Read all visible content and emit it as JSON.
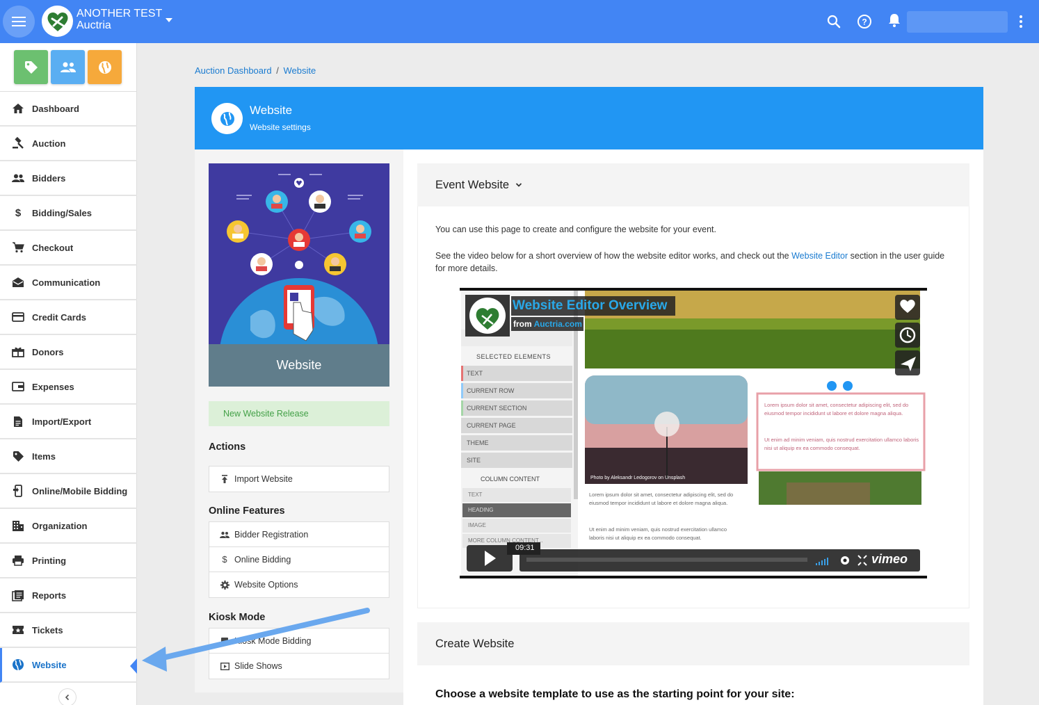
{
  "topbar": {
    "org_name": "ANOTHER TEST",
    "org_sub": "Auctria",
    "icons": [
      "menu-icon",
      "search-icon",
      "help-icon",
      "bell-icon",
      "more-vert-icon"
    ]
  },
  "sidebar": {
    "quick_links": [
      {
        "icon": "tag-icon",
        "color": "#6cc070"
      },
      {
        "icon": "people-icon",
        "color": "#5aaef2"
      },
      {
        "icon": "globe-icon",
        "color": "#f6a93b"
      }
    ],
    "items": [
      {
        "label": "Dashboard",
        "icon": "home-icon"
      },
      {
        "label": "Auction",
        "icon": "gavel-icon"
      },
      {
        "label": "Bidders",
        "icon": "people-icon"
      },
      {
        "label": "Bidding/Sales",
        "icon": "dollar-icon"
      },
      {
        "label": "Checkout",
        "icon": "cart-icon"
      },
      {
        "label": "Communication",
        "icon": "mail-icon"
      },
      {
        "label": "Credit Cards",
        "icon": "credit-card-icon"
      },
      {
        "label": "Donors",
        "icon": "gift-icon"
      },
      {
        "label": "Expenses",
        "icon": "expense-icon"
      },
      {
        "label": "Import/Export",
        "icon": "document-icon"
      },
      {
        "label": "Items",
        "icon": "tag-icon"
      },
      {
        "label": "Online/Mobile Bidding",
        "icon": "mobile-icon"
      },
      {
        "label": "Organization",
        "icon": "building-icon"
      },
      {
        "label": "Printing",
        "icon": "printer-icon"
      },
      {
        "label": "Reports",
        "icon": "reports-icon"
      },
      {
        "label": "Tickets",
        "icon": "ticket-icon"
      },
      {
        "label": "Website",
        "icon": "globe-icon",
        "active": true
      }
    ]
  },
  "breadcrumb": {
    "root": "Auction Dashboard",
    "separator": "/",
    "current": "Website"
  },
  "header": {
    "title": "Website",
    "subtitle": "Website settings"
  },
  "left": {
    "promo_label": "Website",
    "release": "New Website Release",
    "actions_title": "Actions",
    "actions": [
      {
        "label": "Import Website",
        "icon": "upload-icon"
      }
    ],
    "online_title": "Online Features",
    "online": [
      {
        "label": "Bidder Registration",
        "icon": "people-icon"
      },
      {
        "label": "Online Bidding",
        "icon": "dollar-icon"
      },
      {
        "label": "Website Options",
        "icon": "gear-icon"
      }
    ],
    "kiosk_title": "Kiosk Mode",
    "kiosk": [
      {
        "label": "Kiosk Mode Bidding",
        "icon": "kiosk-icon"
      },
      {
        "label": "Slide Shows",
        "icon": "slideshow-icon"
      }
    ]
  },
  "event_website": {
    "title": "Event Website",
    "para1": "You can use this page to create and configure the website for your event.",
    "para2_pre": "See the video below for a short overview of how the website editor works, and check out the ",
    "para2_link": "Website Editor",
    "para2_post": " section in the user guide for more details."
  },
  "video": {
    "title": "Website Editor Overview",
    "from_label": "from",
    "from_link": "Auctria.com",
    "duration": "09:31",
    "brand": "vimeo",
    "panel_header": "SELECTED ELEMENTS",
    "panel_items": [
      "TEXT",
      "CURRENT ROW",
      "CURRENT SECTION",
      "CURRENT PAGE",
      "THEME",
      "SITE"
    ],
    "column_header": "COLUMN CONTENT",
    "column_items": [
      "TEXT",
      "HEADING",
      "IMAGE",
      "MORE COLUMN CONTENT..."
    ],
    "photo_credit": "Photo by Aleksandr Ledogorov on Unsplash",
    "lorem1": "Lorem ipsum dolor sit amet, consectetur adipiscing elit, sed do eiusmod tempor incididunt ut labore et dolore magna aliqua.",
    "lorem2": "Ut enim ad minim veniam, quis nostrud exercitation ullamco laboris nisi ut aliquip ex ea commodo consequat."
  },
  "create_website": {
    "title": "Create Website",
    "choose": "Choose a website template to use as the starting point for your site:"
  }
}
